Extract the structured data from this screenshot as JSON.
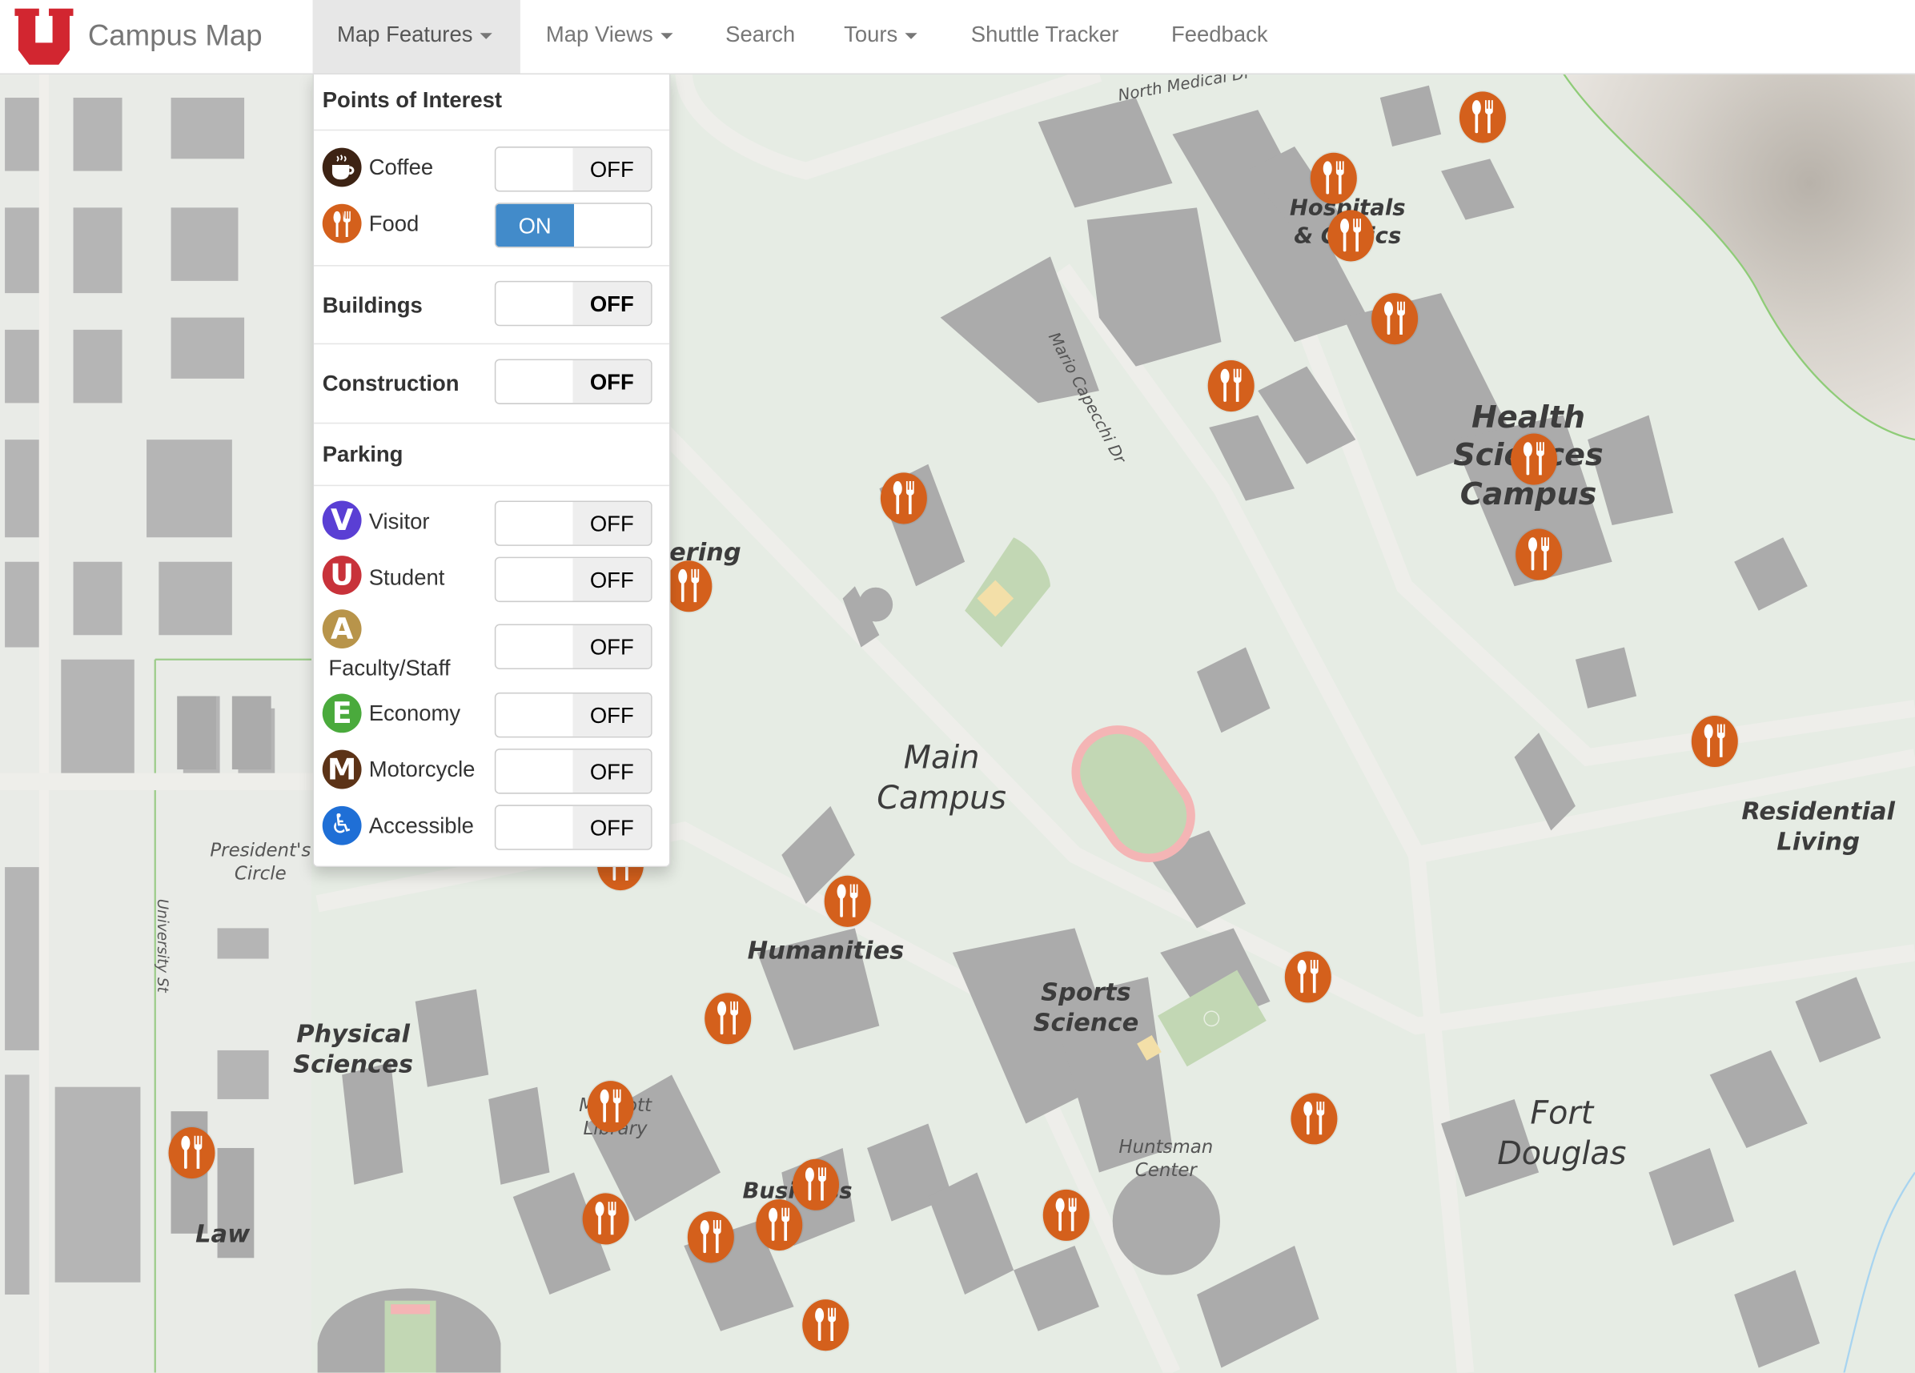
{
  "app": {
    "title": "Campus Map",
    "logo": "university-u-logo",
    "brand_color": "#d22630"
  },
  "nav": {
    "items": [
      {
        "label": "Map Features",
        "dropdown": true,
        "active": true
      },
      {
        "label": "Map Views",
        "dropdown": true,
        "active": false
      },
      {
        "label": "Search",
        "dropdown": false,
        "active": false
      },
      {
        "label": "Tours",
        "dropdown": true,
        "active": false
      },
      {
        "label": "Shuttle Tracker",
        "dropdown": false,
        "active": false
      },
      {
        "label": "Feedback",
        "dropdown": false,
        "active": false
      }
    ]
  },
  "features_menu": {
    "points_of_interest": {
      "header": "Points of Interest",
      "items": [
        {
          "label": "Coffee",
          "icon": "coffee-cup-icon",
          "color": "#3d2314",
          "state": "OFF"
        },
        {
          "label": "Food",
          "icon": "fork-spoon-icon",
          "color": "#d4601c",
          "state": "ON"
        }
      ]
    },
    "buildings": {
      "label": "Buildings",
      "state": "OFF"
    },
    "construction": {
      "label": "Construction",
      "state": "OFF"
    },
    "parking": {
      "header": "Parking",
      "items": [
        {
          "label": "Visitor",
          "letter": "V",
          "color": "#5a3fd4",
          "state": "OFF"
        },
        {
          "label": "Student",
          "letter": "U",
          "color": "#c8323a",
          "state": "OFF"
        },
        {
          "label": "Faculty/Staff",
          "letter": "A",
          "color": "#b8944a",
          "state": "OFF"
        },
        {
          "label": "Economy",
          "letter": "E",
          "color": "#4aaa3c",
          "state": "OFF"
        },
        {
          "label": "Motorcycle",
          "letter": "M",
          "color": "#5c3317",
          "state": "OFF"
        },
        {
          "label": "Accessible",
          "letter": "♿",
          "color": "#1f6fd6",
          "state": "OFF"
        }
      ]
    },
    "switch_on_color": "#428bca"
  },
  "map": {
    "region_labels": [
      {
        "text": "Health Sciences Campus",
        "lines": [
          "Health",
          "Sciences",
          "Campus"
        ]
      },
      {
        "text": "Main Campus",
        "lines": [
          "Main",
          "Campus"
        ]
      },
      {
        "text": "Residential Living",
        "lines": [
          "Residential",
          "Living"
        ]
      },
      {
        "text": "Fort Douglas",
        "lines": [
          "Fort",
          "Douglas"
        ]
      },
      {
        "text": "Physical Sciences",
        "lines": [
          "Physical",
          "Sciences"
        ]
      },
      {
        "text": "Hospitals & Clinics",
        "lines": [
          "Hospitals",
          "& Clinics"
        ]
      },
      {
        "text": "Humanities",
        "lines": [
          "Humanities"
        ]
      },
      {
        "text": "Sports Science",
        "lines": [
          "Sports",
          "Science"
        ]
      },
      {
        "text": "Business",
        "lines": [
          "Business"
        ]
      },
      {
        "text": "Law",
        "lines": [
          "Law"
        ]
      },
      {
        "text": "Engineering",
        "lines": [
          "ering"
        ]
      }
    ],
    "place_labels": [
      {
        "text": "President's Circle",
        "lines": [
          "President's",
          "Circle"
        ]
      },
      {
        "text": "Huntsman Center",
        "lines": [
          "Huntsman",
          "Center"
        ]
      },
      {
        "text": "Marriott Library",
        "lines": [
          "Marriott",
          "Library"
        ]
      }
    ],
    "street_labels": [
      "North Medical Dr",
      "Mario Capecchi Dr",
      "University St"
    ],
    "marker_type": "food",
    "marker_color": "#d4601c",
    "food_marker_count": 23
  }
}
